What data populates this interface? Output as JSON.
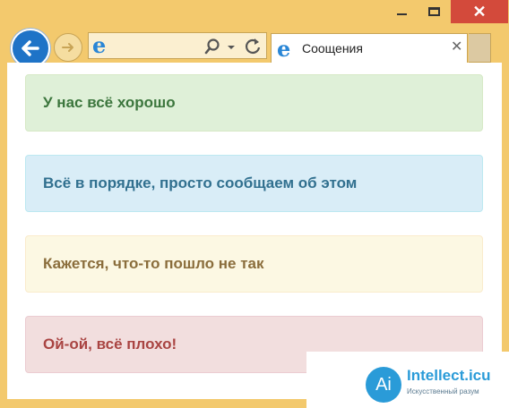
{
  "window": {
    "minimize_icon": "minimize-icon",
    "maximize_icon": "maximize-icon",
    "close_glyph": "✕"
  },
  "nav": {
    "back_icon": "arrow-left-icon",
    "forward_icon": "arrow-right-icon",
    "address_value": "",
    "search_icon": "search-icon",
    "refresh_icon": "refresh-icon"
  },
  "tab": {
    "title": "Соощения",
    "close_glyph": "✕"
  },
  "alerts": [
    {
      "type": "success",
      "text": "У нас всё хорошо",
      "color": "#3c763d",
      "background": "#dff0d8"
    },
    {
      "type": "info",
      "text": "Всё в порядке, просто сообщаем об этом",
      "color": "#31708f",
      "background": "#d9edf7"
    },
    {
      "type": "warning",
      "text": "Кажется, что-то пошло не так",
      "color": "#8a6d3b",
      "background": "#fcf8e3"
    },
    {
      "type": "danger",
      "text": "Ой-ой, всё плохо!",
      "color": "#a94442",
      "background": "#f2dede"
    }
  ],
  "watermark": {
    "logo_glyph": "Ai",
    "name": "Intellect.icu",
    "tagline": "Искусственный разум"
  }
}
